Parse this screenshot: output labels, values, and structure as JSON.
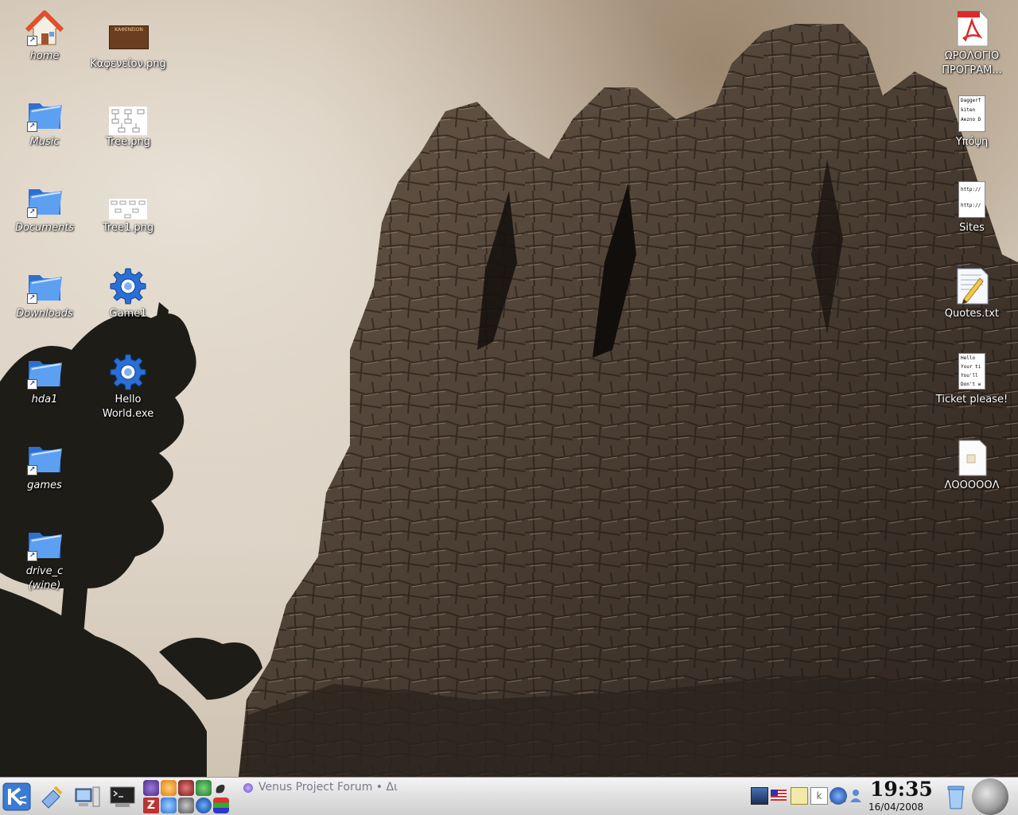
{
  "desktop": {
    "left_column": [
      {
        "label": "home",
        "icon": "home-icon"
      },
      {
        "label": "Music",
        "icon": "folder-icon"
      },
      {
        "label": "Documents",
        "icon": "folder-icon"
      },
      {
        "label": "Downloads",
        "icon": "folder-icon"
      },
      {
        "label": "hda1",
        "icon": "folder-icon"
      },
      {
        "label": "games",
        "icon": "folder-icon"
      },
      {
        "label": "drive_c (wine)",
        "icon": "folder-icon"
      }
    ],
    "second_column": [
      {
        "label": "Καφενείον.png",
        "icon": "image-thumbnail-icon"
      },
      {
        "label": "Tree.png",
        "icon": "image-thumbnail-icon"
      },
      {
        "label": "Tree1.png",
        "icon": "image-thumbnail-icon"
      },
      {
        "label": "Game1",
        "icon": "gear-icon"
      },
      {
        "label": "Hello World.exe",
        "icon": "gear-icon"
      }
    ],
    "right_column": [
      {
        "label": "ΩΡΟΛΟΓΙΟ ΠΡΟΓΡΑΜ...",
        "icon": "pdf-document-icon"
      },
      {
        "label": "Υπόψη",
        "icon": "text-document-icon"
      },
      {
        "label": "Sites",
        "icon": "text-document-icon"
      },
      {
        "label": "Quotes.txt",
        "icon": "text-file-icon"
      },
      {
        "label": "Ticket please!",
        "icon": "text-document-icon"
      },
      {
        "label": "ΛΟΟΟΟΟΛ",
        "icon": "blank-document-icon"
      }
    ],
    "thumb_text": {
      "kafeneion": "ΚΑΦΕΝΕΙΟΝ",
      "yposi": [
        "Daggerf",
        "kiten",
        "Aezno D"
      ],
      "sites": [
        "http://",
        "http://"
      ],
      "ticket": [
        "Hello",
        "Your ti",
        "You'll",
        "Don't w"
      ]
    }
  },
  "taskbar": {
    "active_task": "Venus Project Forum • Δι",
    "clock_time": "19:35",
    "clock_date": "16/04/2008",
    "start_button": "kde-start-icon",
    "colors": {
      "folder": "#3f86e8",
      "gear": "#2a6fd6",
      "taskbar": "#e2e2e2"
    }
  }
}
